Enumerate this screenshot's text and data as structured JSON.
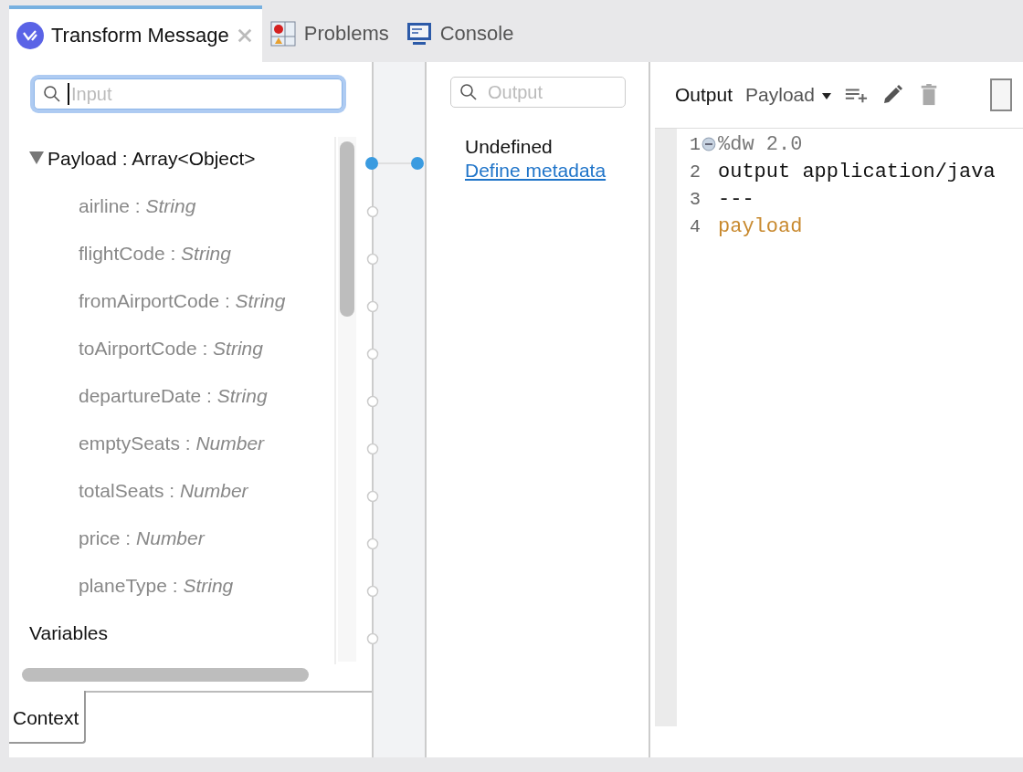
{
  "tabs": [
    {
      "label": "Transform Message",
      "kind": "transform",
      "selected": true,
      "closable": true
    },
    {
      "label": "Problems",
      "kind": "problems",
      "selected": false,
      "closable": false
    },
    {
      "label": "Console",
      "kind": "console",
      "selected": false,
      "closable": false
    }
  ],
  "input_panel": {
    "search": {
      "placeholder": "Input",
      "focused": true
    },
    "tree": [
      {
        "label": "Payload : Array<Object>",
        "expanded": true,
        "mapped": true,
        "children": [
          {
            "label": "airline : *String*"
          },
          {
            "label": "flightCode : *String*"
          },
          {
            "label": "fromAirportCode : *String*"
          },
          {
            "label": "toAirportCode : *String*"
          },
          {
            "label": "departureDate : *String*"
          },
          {
            "label": "emptySeats : *Number*"
          },
          {
            "label": "totalSeats : *Number*"
          },
          {
            "label": "price : *Number*"
          },
          {
            "label": "planeType : *String*"
          }
        ]
      },
      {
        "label": "Variables",
        "mapped": false
      }
    ],
    "bottom_tabs": [
      {
        "label": "Context",
        "selected": true
      }
    ]
  },
  "output_panel": {
    "search": {
      "placeholder": "Output"
    },
    "message": "Undefined",
    "link": "Define metadata"
  },
  "editor": {
    "toolbar": {
      "label": "Output",
      "dropdown": "Payload"
    },
    "lines": [
      {
        "number": "1",
        "text": "%dw 2.0",
        "kind": "directive",
        "foldable": true
      },
      {
        "number": "2",
        "text": "output application/java",
        "kind": "plain",
        "foldable": false
      },
      {
        "number": "3",
        "text": "---",
        "kind": "plain",
        "foldable": false
      },
      {
        "number": "4",
        "text": "payload",
        "kind": "keyword",
        "foldable": false
      }
    ]
  }
}
